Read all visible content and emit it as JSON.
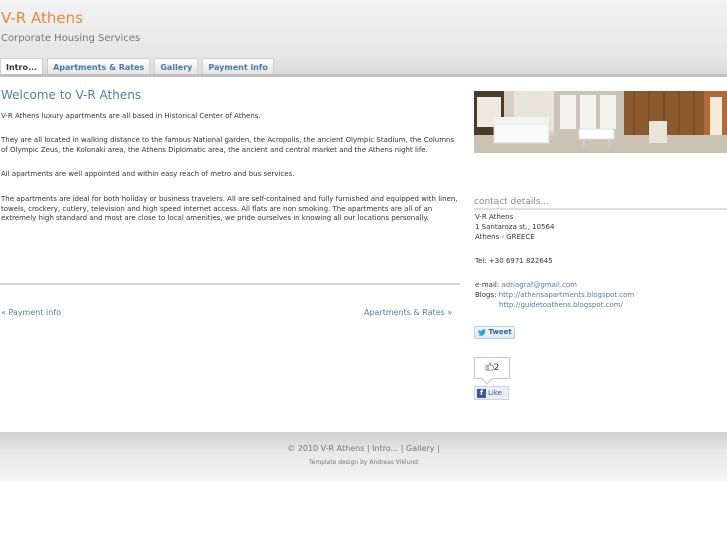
{
  "site": {
    "title": "V-R Athens",
    "tagline": "Corporate Housing Services"
  },
  "tabs": [
    {
      "label": "Intro..."
    },
    {
      "label": "Apartments & Rates"
    },
    {
      "label": "Gallery"
    },
    {
      "label": "Payment info"
    }
  ],
  "main": {
    "heading": "Welcome to V-R Athens",
    "paragraphs": [
      "V-R Athens luxury apartments are all based in Historical Center of Athens.",
      "They are all located in walking distance to the famous National garden, the Acropolis, the ancient Olympic Stadium, the Columns of Olympic Zeus, the Kolonaki area, the Athens Diplomatic area, the ancient and central market and the Athens night life.",
      "All apartments are well appointed and within easy reach of metro and bus services.",
      "The apartments are ideal for both holiday or business travelers. All are self-contained and fully furnished and equipped with linen, towels, crockery, cutlery, television and high speed internet access. All flats are non smoking. The apartments are all of an extremely high standard and most are close to local amenities, we pride ourselves in knowing all our locations personally."
    ],
    "prev_arrow": "«",
    "prev_link": "Payment info",
    "next_link": "Apartments & Rates",
    "next_arrow": "»"
  },
  "sidebar": {
    "contact_heading": "contact details...",
    "address": [
      "V-R Athens",
      "1 Santaroza st., 10564",
      "Athens - GREECE"
    ],
    "tel": "Tel: +30 6971 822645",
    "email_label": "e-mail:",
    "email": "adriagraf@gmail.com",
    "blogs_label": "Blogs:",
    "blog1": "http://athensapartments.blogspot.com",
    "blog2": "http://guidetoathens.blogspot.com/",
    "tweet_label": "Tweet",
    "like_count": "2",
    "like_label": "Like"
  },
  "icons": {
    "tweet": "twitter-bird-icon",
    "thumbs": "thumbs-up-icon",
    "facebook": "facebook-f-icon"
  },
  "footer": {
    "copyright": "© 2010 V-R Athens",
    "sep": "|",
    "link_intro": "Intro...",
    "link_gallery": "Gallery",
    "credit": "Template design by Andreas Viklund"
  },
  "colors": {
    "title_orange": "#e8893a",
    "link_blue": "#4f7fa8"
  }
}
